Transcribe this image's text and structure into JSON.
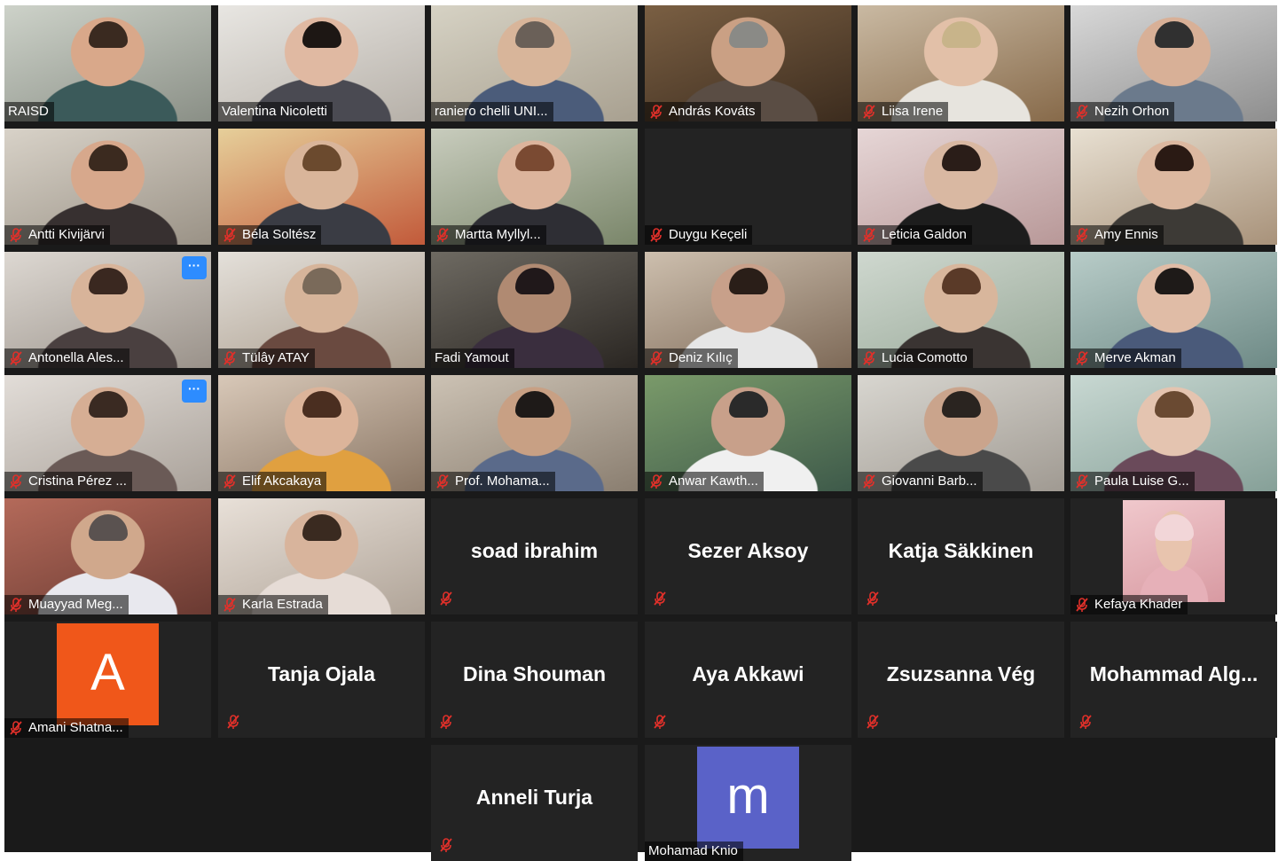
{
  "meeting": {
    "participants": [
      {
        "name": "RAISD",
        "type": "video",
        "muted": false,
        "bg1": "#cdd2c9",
        "bg2": "#8a8f86",
        "skin": "#d9a88a",
        "shirt": "#3b5a5a",
        "hair": "#3a2a20"
      },
      {
        "name": "Valentina Nicoletti",
        "type": "video",
        "muted": false,
        "bg1": "#e8e6e2",
        "bg2": "#b6b0a8",
        "skin": "#e0b9a2",
        "shirt": "#4a4a52",
        "hair": "#1d1714"
      },
      {
        "name": "raniero chelli UNI...",
        "type": "video",
        "muted": false,
        "bg1": "#d6d2c4",
        "bg2": "#a8a090",
        "skin": "#d8b59a",
        "shirt": "#4b5c7a",
        "hair": "#6a6058"
      },
      {
        "name": "András Kováts",
        "type": "video",
        "muted": true,
        "bg1": "#7a5f43",
        "bg2": "#3c2c1e",
        "skin": "#caa084",
        "shirt": "#5a4d44",
        "hair": "#8a8a86"
      },
      {
        "name": "Liisa Irene",
        "type": "video",
        "muted": true,
        "bg1": "#c9b9a2",
        "bg2": "#876a4a",
        "skin": "#e2c0a8",
        "shirt": "#e7e4de",
        "hair": "#c8b48a"
      },
      {
        "name": "Nezih Orhon",
        "type": "video",
        "muted": true,
        "bg1": "#d8d8d8",
        "bg2": "#8e8e8e",
        "skin": "#d8b097",
        "shirt": "#6b7a8c",
        "hair": "#303030"
      },
      {
        "name": "Antti Kivijärvi",
        "type": "video",
        "muted": true,
        "bg1": "#d8d2c8",
        "bg2": "#9a9286",
        "skin": "#d7a88c",
        "shirt": "#373030",
        "hair": "#3b2a1f"
      },
      {
        "name": "Béla Soltész",
        "type": "video",
        "muted": true,
        "bg1": "#e6cf9a",
        "bg2": "#c25a3a",
        "skin": "#d9b59a",
        "shirt": "#3a3c44",
        "hair": "#6b4a2e"
      },
      {
        "name": "Martta Myllyl...",
        "type": "video",
        "muted": true,
        "bg1": "#c8ccbd",
        "bg2": "#7a866a",
        "skin": "#dcb49c",
        "shirt": "#2e2e34",
        "hair": "#7a4a32"
      },
      {
        "name": "Duygu Keçeli",
        "type": "blank",
        "muted": true
      },
      {
        "name": "Leticia Galdon",
        "type": "video",
        "muted": true,
        "bg1": "#e6d6d6",
        "bg2": "#b89898",
        "skin": "#d9b8a2",
        "shirt": "#1d1d1d",
        "hair": "#2a1d18"
      },
      {
        "name": "Amy Ennis",
        "type": "video",
        "muted": true,
        "bg1": "#e8e0d2",
        "bg2": "#a8927a",
        "skin": "#dcb8a0",
        "shirt": "#3d3a36",
        "hair": "#2a1a14"
      },
      {
        "name": "Antonella Ales...",
        "type": "video",
        "muted": true,
        "more": true,
        "bg1": "#ddd8d2",
        "bg2": "#9a928a",
        "skin": "#d8b49a",
        "shirt": "#4a4040",
        "hair": "#3a2820"
      },
      {
        "name": "Tülây ATAY",
        "type": "video",
        "muted": true,
        "bg1": "#e4e0da",
        "bg2": "#a89a8a",
        "skin": "#d6b49a",
        "shirt": "#6a4a40",
        "hair": "#7a6a5a"
      },
      {
        "name": "Fadi Yamout",
        "type": "video",
        "muted": false,
        "active": true,
        "bg1": "#6e6a62",
        "bg2": "#2a2622",
        "skin": "#b08a72",
        "shirt": "#3a2e3e",
        "hair": "#20181a"
      },
      {
        "name": "Deniz Kılıç",
        "type": "video",
        "muted": true,
        "bg1": "#cdbfae",
        "bg2": "#7e6a58",
        "skin": "#c8a08a",
        "shirt": "#e6e6e6",
        "hair": "#2a1e18"
      },
      {
        "name": "Lucia Comotto",
        "type": "video",
        "muted": true,
        "bg1": "#cfd8cf",
        "bg2": "#98a898",
        "skin": "#d8b69c",
        "shirt": "#3a3432",
        "hair": "#5a3a28"
      },
      {
        "name": "Merve Akman",
        "type": "video",
        "muted": true,
        "bg1": "#b8ccc8",
        "bg2": "#6e8a86",
        "skin": "#e0bca6",
        "shirt": "#4a5a7a",
        "hair": "#1e1a18"
      },
      {
        "name": "Cristina Pérez ...",
        "type": "video",
        "muted": true,
        "more": true,
        "bg1": "#e2ddd8",
        "bg2": "#aaa29a",
        "skin": "#d6ae94",
        "shirt": "#6a5a56",
        "hair": "#3a2a22"
      },
      {
        "name": "Elif Akcakaya",
        "type": "video",
        "muted": true,
        "bg1": "#d8c8b8",
        "bg2": "#8a7664",
        "skin": "#dcb49a",
        "shirt": "#e0a040",
        "hair": "#4a2e20"
      },
      {
        "name": "Prof. Mohama...",
        "type": "video",
        "muted": true,
        "bg1": "#ccc2b4",
        "bg2": "#8a7e70",
        "skin": "#c8a084",
        "shirt": "#5a6a8a",
        "hair": "#1e1a18"
      },
      {
        "name": "Anwar Kawth...",
        "type": "video",
        "muted": true,
        "bg1": "#7a9a6a",
        "bg2": "#3e5a4a",
        "skin": "#c8a08a",
        "shirt": "#f0f0f0",
        "hair": "#2a2a2a"
      },
      {
        "name": "Giovanni Barb...",
        "type": "video",
        "muted": true,
        "bg1": "#d8d6d0",
        "bg2": "#a09a92",
        "skin": "#caa48c",
        "shirt": "#4a4a4a",
        "hair": "#2a2420"
      },
      {
        "name": "Paula Luise G...",
        "type": "video",
        "muted": true,
        "bg1": "#c8d8d2",
        "bg2": "#86a098",
        "skin": "#e4c4b0",
        "shirt": "#6a4a5a",
        "hair": "#6a4a32"
      },
      {
        "name": "Muayyad Meg...",
        "type": "video",
        "muted": true,
        "bg1": "#b46a5a",
        "bg2": "#6a3a32",
        "skin": "#d0a88c",
        "shirt": "#e8e8ee",
        "hair": "#5a5250"
      },
      {
        "name": "Karla Estrada",
        "type": "video",
        "muted": true,
        "bg1": "#e8e0d8",
        "bg2": "#b0a498",
        "skin": "#d8b49c",
        "shirt": "#e6dcd6",
        "hair": "#3a2a20"
      },
      {
        "name": "soad ibrahim",
        "type": "name",
        "muted": true
      },
      {
        "name": "Sezer Aksoy",
        "type": "name",
        "muted": true
      },
      {
        "name": "Katja Säkkinen",
        "type": "name",
        "muted": true
      },
      {
        "name": "Kefaya Khader",
        "type": "photo-avatar",
        "muted": true,
        "bg1": "#f0c8cc",
        "bg2": "#d89aa2",
        "skin": "#e8c4ae",
        "shirt": "#e6b0b8",
        "hair": "#f2d6d8"
      },
      {
        "name": "Amani Shatna...",
        "type": "letter-avatar",
        "letter": "A",
        "color": "#f0571a",
        "muted": true
      },
      {
        "name": "Tanja Ojala",
        "type": "name",
        "muted": true
      },
      {
        "name": "Dina Shouman",
        "type": "name",
        "muted": true
      },
      {
        "name": "Aya Akkawi",
        "type": "name",
        "muted": true
      },
      {
        "name": "Zsuzsanna Vég",
        "type": "name",
        "muted": true
      },
      {
        "name": "Mohammad  Alg...",
        "type": "name",
        "muted": true
      },
      {
        "name": "Anneli Turja",
        "type": "name",
        "muted": true
      },
      {
        "name": "Mohamad Knio",
        "type": "letter-avatar",
        "letter": "m",
        "color": "#5a62c8",
        "muted": false
      }
    ]
  },
  "icons": {
    "muted": "mic-muted-icon",
    "more": "more-options-icon"
  },
  "colors": {
    "mute_red": "#e0302a",
    "active_border": "#c9d94a",
    "more_blue": "#2d8cff"
  },
  "more_label": "···"
}
